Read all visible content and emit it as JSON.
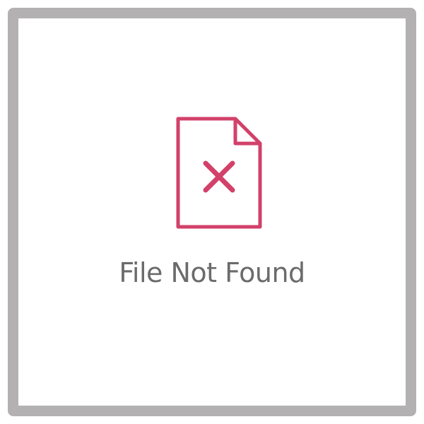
{
  "error": {
    "message": "File Not Found",
    "icon": "file-error-icon"
  },
  "colors": {
    "frame": "#b3b1b2",
    "background": "#ffffff",
    "icon": "#d2416a",
    "text": "#6b6b6b"
  }
}
